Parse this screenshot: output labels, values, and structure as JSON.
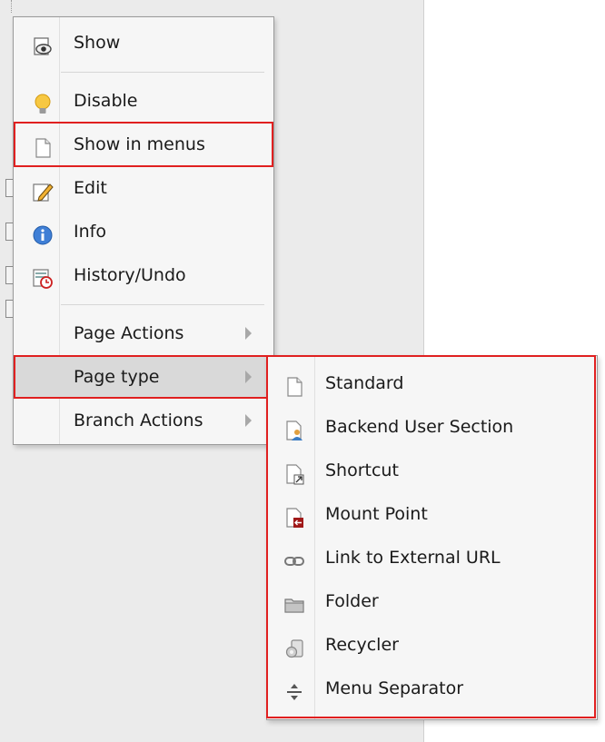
{
  "context_menu": {
    "items": [
      {
        "label": "Show",
        "icon": "eye-icon"
      },
      {
        "label": "Disable",
        "icon": "lightbulb-icon"
      },
      {
        "label": "Show in menus",
        "icon": "page-icon"
      },
      {
        "label": "Edit",
        "icon": "pencil-icon"
      },
      {
        "label": "Info",
        "icon": "info-icon"
      },
      {
        "label": "History/Undo",
        "icon": "history-icon"
      },
      {
        "label": "Page Actions"
      },
      {
        "label": "Page type"
      },
      {
        "label": "Branch Actions"
      }
    ]
  },
  "page_type_submenu": {
    "items": [
      {
        "label": "Standard",
        "icon": "page-icon"
      },
      {
        "label": "Backend User Section",
        "icon": "backend-user-section-icon"
      },
      {
        "label": "Shortcut",
        "icon": "shortcut-icon"
      },
      {
        "label": "Mount Point",
        "icon": "mount-point-icon"
      },
      {
        "label": "Link to External URL",
        "icon": "link-icon"
      },
      {
        "label": "Folder",
        "icon": "folder-icon"
      },
      {
        "label": "Recycler",
        "icon": "recycler-icon"
      },
      {
        "label": "Menu Separator",
        "icon": "separator-icon"
      }
    ]
  },
  "colors": {
    "highlight_border": "#e02020",
    "menu_background": "#f6f6f6",
    "active_item": "#d9d9d9"
  }
}
